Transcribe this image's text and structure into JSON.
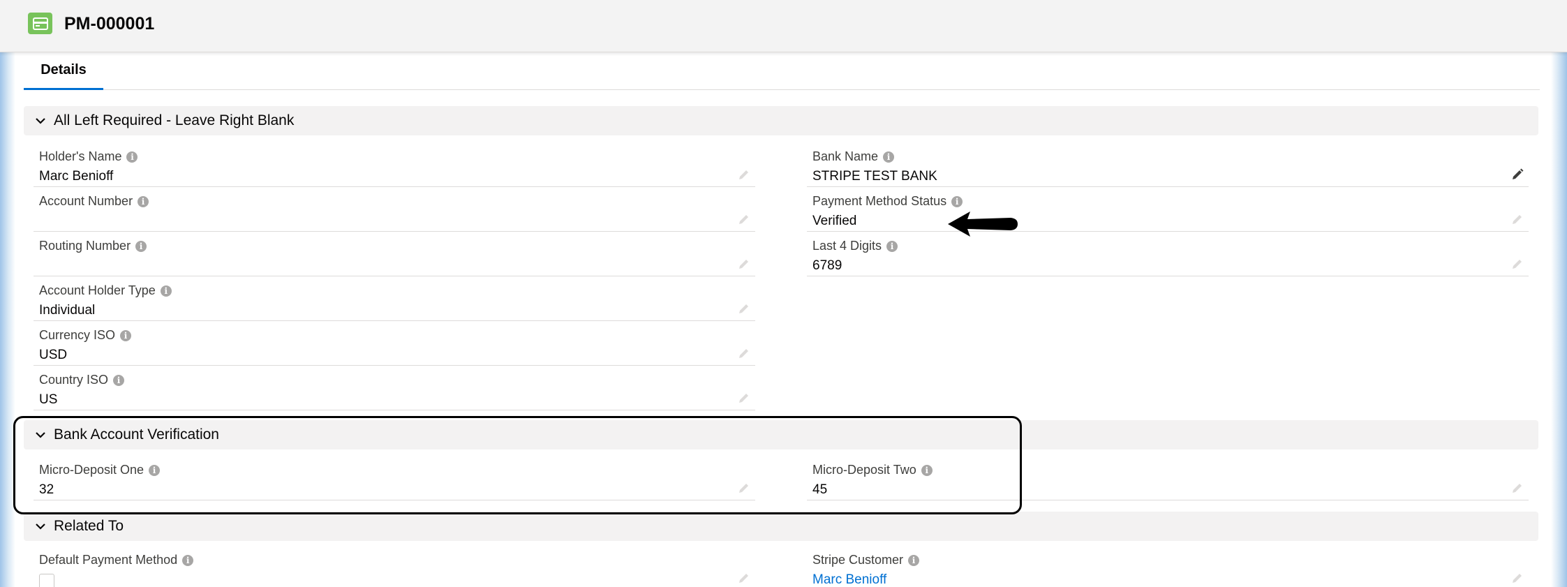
{
  "header": {
    "record_icon": "payment-card-icon",
    "record_title": "PM-000001"
  },
  "tabs": [
    {
      "label": "Details",
      "active": true
    }
  ],
  "sections": {
    "required": {
      "title": "All Left Required - Leave Right Blank",
      "left_fields": [
        {
          "label": "Holder's Name",
          "value": "Marc Benioff"
        },
        {
          "label": "Account Number",
          "value": ""
        },
        {
          "label": "Routing Number",
          "value": ""
        },
        {
          "label": "Account Holder Type",
          "value": "Individual"
        },
        {
          "label": "Currency ISO",
          "value": "USD"
        },
        {
          "label": "Country ISO",
          "value": "US"
        }
      ],
      "right_fields": [
        {
          "label": "Bank Name",
          "value": "STRIPE TEST BANK"
        },
        {
          "label": "Payment Method Status",
          "value": "Verified"
        },
        {
          "label": "Last 4 Digits",
          "value": "6789"
        }
      ]
    },
    "verification": {
      "title": "Bank Account Verification",
      "left_fields": [
        {
          "label": "Micro-Deposit One",
          "value": "32"
        }
      ],
      "right_fields": [
        {
          "label": "Micro-Deposit Two",
          "value": "45"
        }
      ]
    },
    "related": {
      "title": "Related To",
      "left_fields": [
        {
          "label": "Default Payment Method",
          "value": "",
          "checked": false
        }
      ],
      "right_fields": [
        {
          "label": "Stripe Customer",
          "value": "Marc Benioff"
        }
      ]
    }
  },
  "colors": {
    "icon_bg": "#78c35b",
    "tab_underline": "#0070d2",
    "link": "#0070d2",
    "section_bg": "#f3f2f2"
  }
}
